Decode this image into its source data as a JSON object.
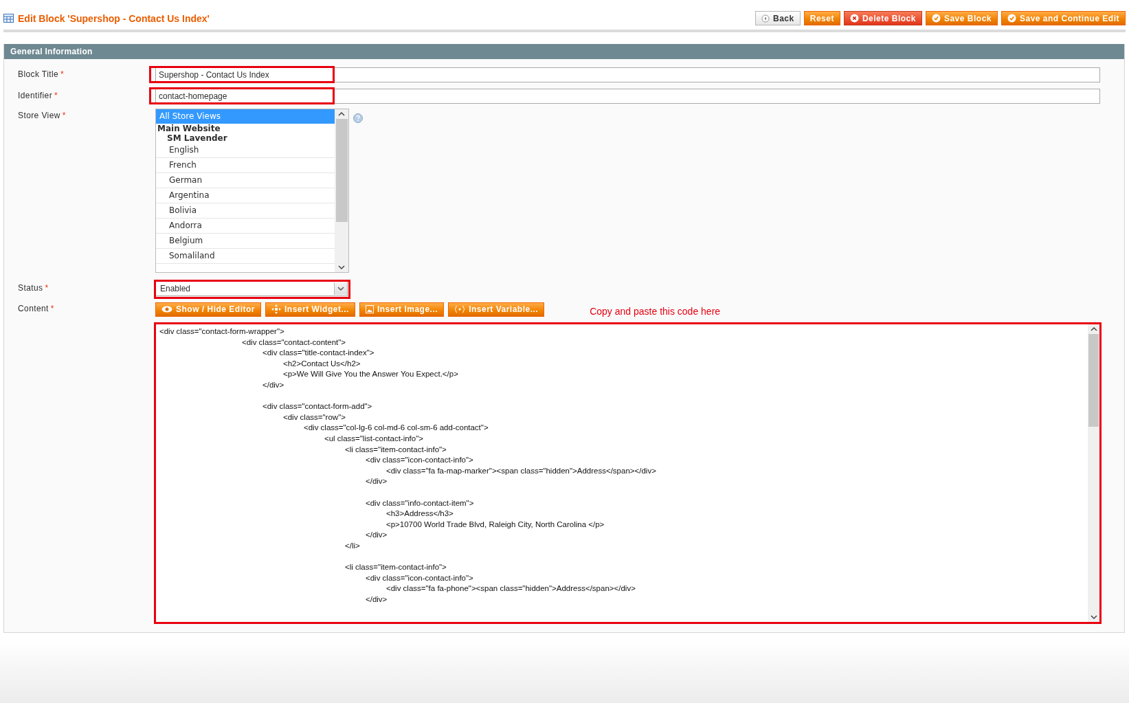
{
  "header": {
    "title": "Edit Block 'Supershop - Contact Us Index'",
    "buttons": [
      {
        "label": "Back",
        "kind": "back"
      },
      {
        "label": "Reset",
        "kind": "plain"
      },
      {
        "label": "Delete Block",
        "kind": "delete"
      },
      {
        "label": "Save Block",
        "kind": "save"
      },
      {
        "label": "Save and Continue Edit",
        "kind": "save"
      }
    ]
  },
  "section": {
    "title": "General Information"
  },
  "fields": [
    {
      "label": "Block Title",
      "required": "*",
      "kind": "text",
      "value": "Supershop - Contact Us Index",
      "highlighted": true
    },
    {
      "label": "Identifier",
      "required": "*",
      "kind": "text",
      "value": "contact-homepage",
      "highlighted": true
    },
    {
      "label": "Store View",
      "required": "*",
      "kind": "multiselect",
      "options": [
        {
          "label": "All Store Views",
          "kind": "option",
          "selected": true
        },
        {
          "label": "Main Website",
          "kind": "group",
          "children": [
            {
              "label": "SM Lavender",
              "kind": "group",
              "children": [
                {
                  "label": "English",
                  "kind": "option",
                  "selected": false
                },
                {
                  "label": "French",
                  "kind": "option",
                  "selected": false
                },
                {
                  "label": "German",
                  "kind": "option",
                  "selected": false
                },
                {
                  "label": "Argentina",
                  "kind": "option",
                  "selected": false
                },
                {
                  "label": "Bolivia",
                  "kind": "option",
                  "selected": false
                },
                {
                  "label": "Andorra",
                  "kind": "option",
                  "selected": false
                },
                {
                  "label": "Belgium",
                  "kind": "option",
                  "selected": false
                },
                {
                  "label": "Somaliland",
                  "kind": "option",
                  "selected": false
                }
              ]
            }
          ]
        }
      ]
    },
    {
      "label": "Status",
      "required": "*",
      "kind": "select",
      "value": "Enabled",
      "highlighted": true
    },
    {
      "label": "Content",
      "required": "*",
      "kind": "editor",
      "highlighted": true,
      "buttons": [
        {
          "label": "Show / Hide Editor",
          "kind": "eye"
        },
        {
          "label": "Insert Widget...",
          "kind": "widget"
        },
        {
          "label": "Insert Image...",
          "kind": "image"
        },
        {
          "label": "Insert Variable...",
          "kind": "variable"
        }
      ],
      "note": "Copy and paste this code here",
      "code": "<div class=\"contact-form-wrapper\">\n\t\t\t\t<div class=\"contact-content\">\n\t\t\t\t\t<div class=\"title-contact-index\">\n\t\t\t\t\t\t<h2>Contact Us</h2>\n\t\t\t\t\t\t<p>We Will Give You the Answer You Expect.</p>\n\t\t\t\t\t</div>\n\n\t\t\t\t\t<div class=\"contact-form-add\">\n\t\t\t\t\t\t<div class=\"row\">\n\t\t\t\t\t\t\t<div class=\"col-lg-6 col-md-6 col-sm-6 add-contact\">\n\t\t\t\t\t\t\t\t<ul class=\"list-contact-info\">\n\t\t\t\t\t\t\t\t\t<li class=\"item-contact-info\">\n\t\t\t\t\t\t\t\t\t\t<div class=\"icon-contact-info\">\n\t\t\t\t\t\t\t\t\t\t\t<div class=\"fa fa-map-marker\"><span class=\"hidden\">Address</span></div>\n\t\t\t\t\t\t\t\t\t\t</div>\n\n\t\t\t\t\t\t\t\t\t\t<div class=\"info-contact-item\">\n\t\t\t\t\t\t\t\t\t\t\t<h3>Address</h3>\n\t\t\t\t\t\t\t\t\t\t\t<p>10700 World Trade Blvd, Raleigh City, North Carolina </p>\n\t\t\t\t\t\t\t\t\t\t</div>\n\t\t\t\t\t\t\t\t\t</li>\n\n\t\t\t\t\t\t\t\t\t<li class=\"item-contact-info\">\n\t\t\t\t\t\t\t\t\t\t<div class=\"icon-contact-info\">\n\t\t\t\t\t\t\t\t\t\t\t<div class=\"fa fa-phone\"><span class=\"hidden\">Address</span></div>\n\t\t\t\t\t\t\t\t\t\t</div>"
    }
  ]
}
